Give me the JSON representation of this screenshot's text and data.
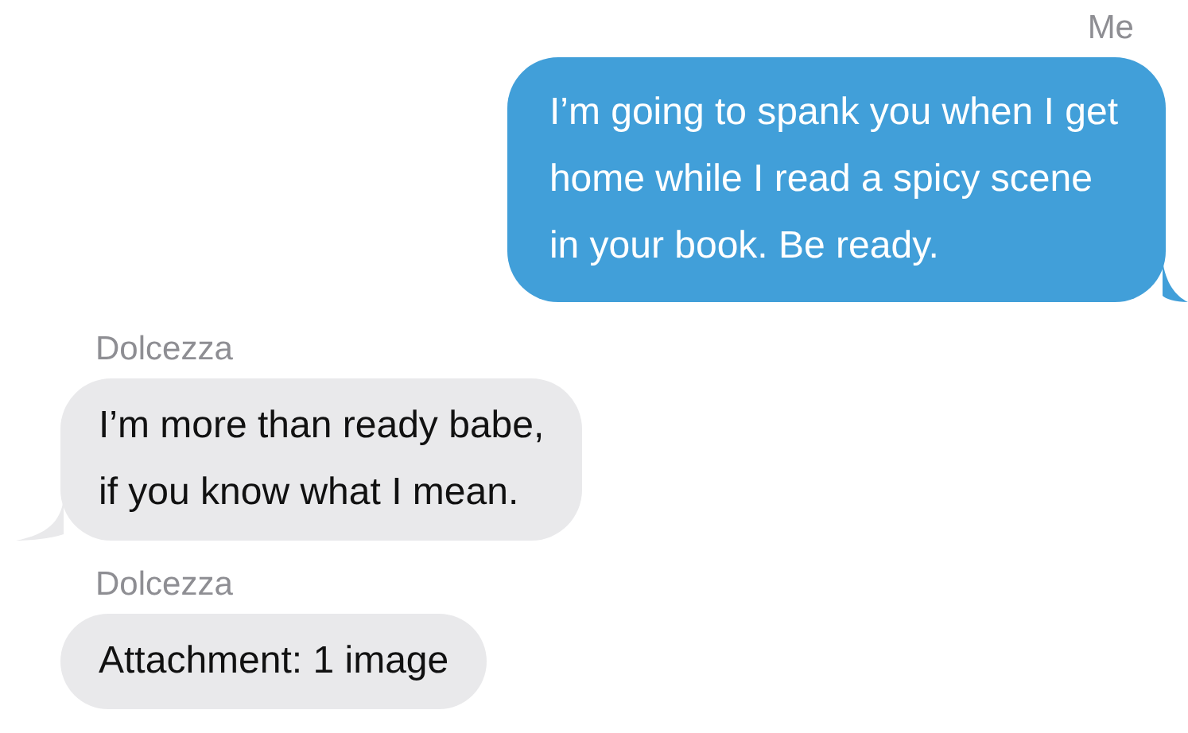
{
  "messages": [
    {
      "kind": "sent",
      "sender": "Me",
      "text": "I’m going to spank you when I get\nhome while I read a spicy scene\nin your book. Be ready.",
      "tail": true
    },
    {
      "kind": "received",
      "sender": "Dolcezza",
      "text": "I’m more than ready babe,\nif you know what I mean.",
      "tail": true
    },
    {
      "kind": "received",
      "sender": "Dolcezza",
      "text": "Attachment: 1 image",
      "tail": false
    }
  ]
}
